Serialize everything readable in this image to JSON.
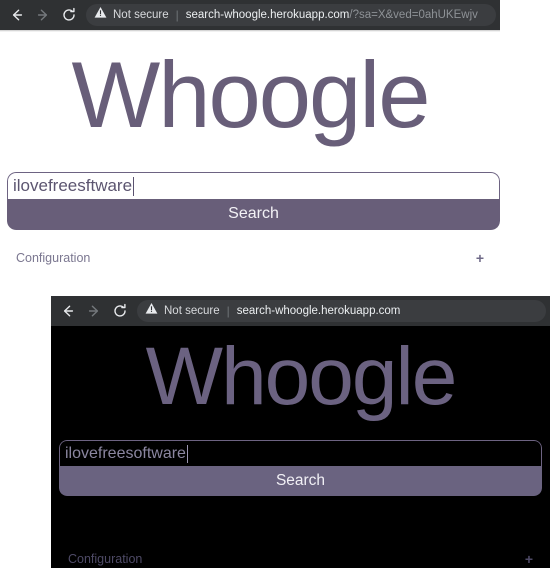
{
  "colors": {
    "accent_purple": "#685e79",
    "chrome_bar": "#2f3133",
    "url_pill": "#3b3d40",
    "dark_page_bg": "#000000",
    "light_page_bg": "#ffffff",
    "dark_logo_purple": "#6b6281"
  },
  "window_light": {
    "browser": {
      "back_icon": "arrow-left-icon",
      "forward_icon": "arrow-right-icon",
      "reload_icon": "reload-icon",
      "warning_icon": "warning-triangle-icon",
      "security_label": "Not secure",
      "divider": "|",
      "url_host": "search-whoogle.herokuapp.com",
      "url_path": "/?sa=X&ved=0ahUKEwjv"
    },
    "page": {
      "logo": "Whoogle",
      "search_value": "ilovefreesftware",
      "search_placeholder": "",
      "search_button": "Search",
      "config_label": "Configuration",
      "config_toggle": "+"
    }
  },
  "window_dark": {
    "browser": {
      "back_icon": "arrow-left-icon",
      "forward_icon": "arrow-right-icon",
      "reload_icon": "reload-icon",
      "warning_icon": "warning-triangle-icon",
      "security_label": "Not secure",
      "divider": "|",
      "url_host": "search-whoogle.herokuapp.com",
      "url_path": ""
    },
    "page": {
      "logo": "Whoogle",
      "search_value": "ilovefreesoftware",
      "search_placeholder": "",
      "search_button": "Search",
      "config_label": "Configuration",
      "config_toggle": "+"
    }
  }
}
